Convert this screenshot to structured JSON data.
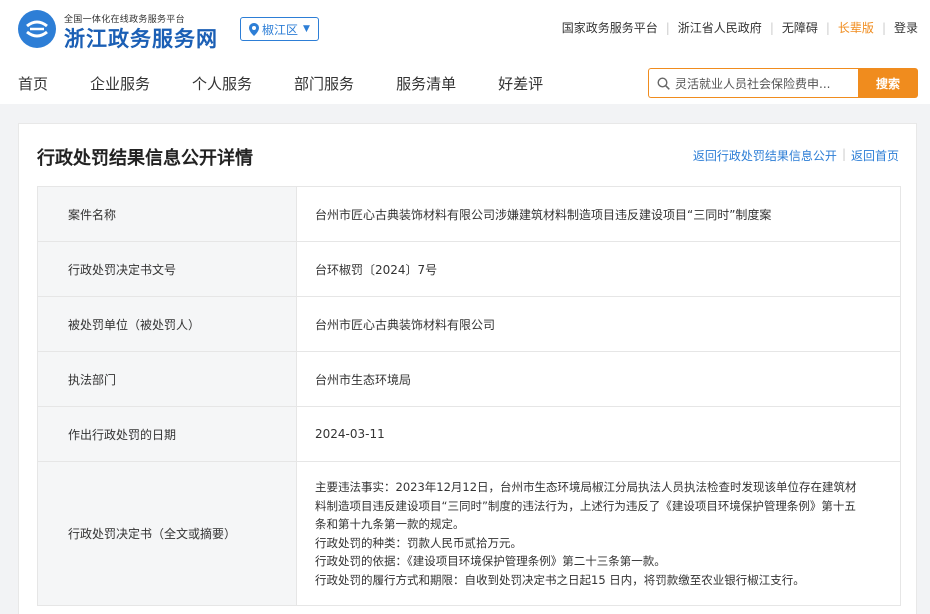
{
  "header": {
    "logo_subtitle": "全国一体化在线政务服务平台",
    "logo_title": "浙江政务服务网",
    "region": "椒江区",
    "links": [
      "国家政务服务平台",
      "浙江省人民政府",
      "无障碍",
      "长辈版",
      "登录"
    ],
    "accent_color": "#f08c1e",
    "brand_color": "#2d7ed6"
  },
  "nav": {
    "items": [
      "首页",
      "企业服务",
      "个人服务",
      "部门服务",
      "服务清单",
      "好差评"
    ]
  },
  "search": {
    "value": "灵活就业人员社会保险费申...",
    "button": "搜索"
  },
  "page": {
    "title": "行政处罚结果信息公开详情",
    "back_list": "返回行政处罚结果信息公开",
    "back_home": "返回首页"
  },
  "details": [
    {
      "label": "案件名称",
      "value": "台州市匠心古典装饰材料有限公司涉嫌建筑材料制造项目违反建设项目“三同时”制度案"
    },
    {
      "label": "行政处罚决定书文号",
      "value": "台环椒罚〔2024〕7号"
    },
    {
      "label": "被处罚单位（被处罚人）",
      "value": "台州市匠心古典装饰材料有限公司"
    },
    {
      "label": "执法部门",
      "value": "台州市生态环境局"
    },
    {
      "label": "作出行政处罚的日期",
      "value": "2024-03-11"
    }
  ],
  "decision": {
    "label": "行政处罚决定书（全文或摘要）",
    "lines": [
      "主要违法事实：2023年12月12日，台州市生态环境局椒江分局执法人员执法检查时发现该单位存在建筑材",
      "料制造项目违反建设项目“三同时”制度的违法行为，上述行为违反了《建设项目环境保护管理条例》第十五",
      "条和第十九条第一款的规定。",
      "行政处罚的种类：罚款人民币贰拾万元。",
      "行政处罚的依据：《建设项目环境保护管理条例》第二十三条第一款。",
      "行政处罚的履行方式和期限：自收到处罚决定书之日起15 日内，将罚款缴至农业银行椒江支行。"
    ]
  }
}
